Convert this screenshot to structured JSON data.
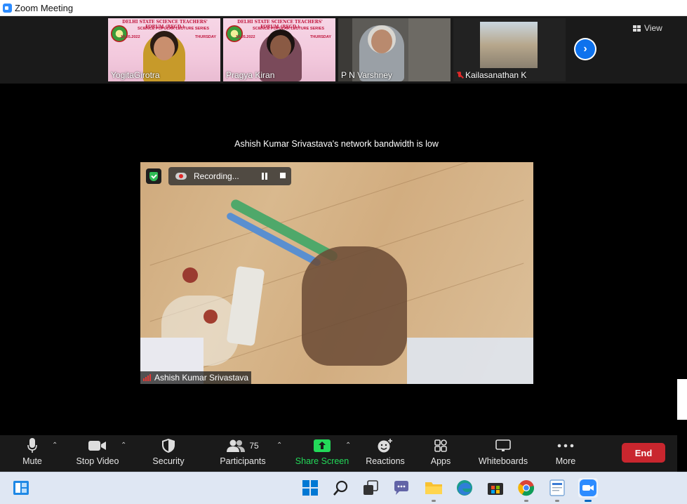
{
  "window": {
    "title": "Zoom Meeting"
  },
  "thumbnails": [
    {
      "name": "YogitaGirotra",
      "poster_title": "DELHI STATE SCIENCE TEACHERS' FORUM (REGD.)",
      "poster_subtitle": "SCIENCE POPULAR LECTURE SERIES",
      "poster_date": "19.05.2022",
      "poster_day": "THURSDAY"
    },
    {
      "name": "Pragya Kiran",
      "poster_title": "DELHI STATE SCIENCE TEACHERS' FORUM (REGD.)",
      "poster_subtitle": "SCIENCE POPULAR LECTURE SERIES",
      "poster_date": "19.05.2022",
      "poster_day": "THURSDAY"
    },
    {
      "name": "P N Varshney"
    },
    {
      "name": "Kailasanathan K",
      "muted": true
    }
  ],
  "view_button": {
    "label": "View",
    "icon": "grid-icon"
  },
  "next_button": {
    "icon": "chevron-right-icon"
  },
  "notice": "Ashish Kumar Srivastava's network bandwidth is low",
  "main_video": {
    "participant": "Ashish Kumar Srivastava",
    "recording_label": "Recording...",
    "pause_icon": "pause-icon",
    "stop_icon": "stop-icon",
    "security_badge_icon": "shield-check-icon"
  },
  "toolbar": {
    "mute": "Mute",
    "stop_video": "Stop Video",
    "security": "Security",
    "participants": "Participants",
    "participants_count": "75",
    "share_screen": "Share Screen",
    "reactions": "Reactions",
    "apps": "Apps",
    "whiteboards": "Whiteboards",
    "more": "More",
    "end": "End"
  },
  "colors": {
    "accent_blue": "#0e72ed",
    "share_green": "#23d959",
    "end_red": "#c9262e",
    "recording_red": "#e02828"
  },
  "taskbar": {
    "icons": [
      "widgets-icon",
      "start-icon",
      "search-icon",
      "task-view-icon",
      "chat-icon",
      "file-explorer-icon",
      "edge-icon",
      "store-icon",
      "chrome-icon",
      "notepad-icon",
      "zoom-icon"
    ]
  }
}
